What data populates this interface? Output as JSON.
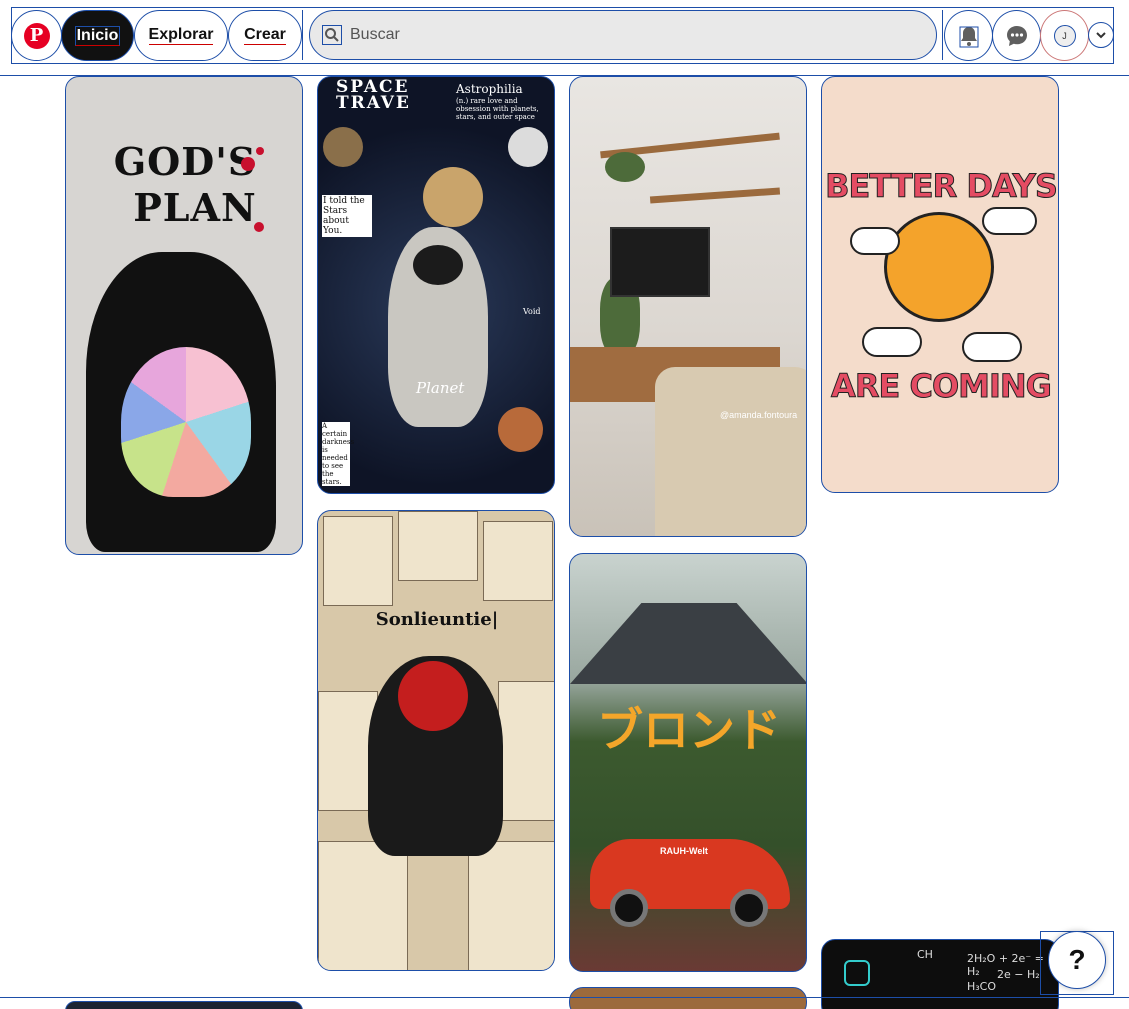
{
  "header": {
    "nav": {
      "home": "Inicio",
      "explore": "Explorar",
      "create": "Crear"
    },
    "search": {
      "placeholder": "Buscar",
      "value": ""
    },
    "avatar_initial": "J",
    "icons": [
      "pinterest-logo",
      "search-icon",
      "bell-icon",
      "chat-icon",
      "chevron-down-icon"
    ]
  },
  "pins": {
    "gods_plan": {
      "line1": "GOD'S",
      "line2": "PLAN"
    },
    "space": {
      "title": "SPACE TRAVE",
      "word": "Astrophilia",
      "def": "(n.) rare love and obsession with planets, stars, and outer space",
      "told": "I told the Stars about You.",
      "planet": "Planet",
      "void": "Void",
      "quote": "A certain darkness is needed to see the stars."
    },
    "living_room": {
      "credit": "@amanda.fontoura"
    },
    "better_days": {
      "line1": "BETTER DAYS",
      "line2": "ARE COMING"
    },
    "spider": {
      "headline": "Sonlieuntie|"
    },
    "car": {
      "jp_text": "ブロンド",
      "brand": "RAUH-Welt"
    },
    "chem": {
      "f1": "2H₂O + 2e⁻ = H₂",
      "f2": "H₃CO",
      "f3": "CH",
      "f4": "2e − H₂"
    }
  },
  "help": {
    "label": "?"
  },
  "colors": {
    "brand": "#e60023",
    "outline": "#1d4ea8"
  }
}
